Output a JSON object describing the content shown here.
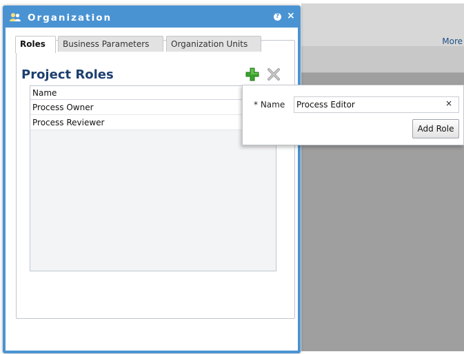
{
  "background": {
    "more_label": "More"
  },
  "dialog": {
    "title": "Organization",
    "help_glyph": "?",
    "close_glyph": "×",
    "tabs": [
      {
        "label": "Roles",
        "active": true
      },
      {
        "label": "Business Parameters",
        "active": false
      },
      {
        "label": "Organization Units",
        "active": false
      }
    ],
    "section_title": "Project Roles",
    "grid": {
      "header": "Name",
      "rows": [
        "Process Owner",
        "Process Reviewer"
      ]
    }
  },
  "popover": {
    "name_label": "* Name",
    "name_value": "Process Editor",
    "clear_glyph": "×",
    "add_button": "Add Role"
  },
  "colors": {
    "dialog_blue": "#4a93d3",
    "title_navy": "#1d3f6e",
    "add_green": "#3aa32c",
    "delete_gray": "#9a9a9a"
  },
  "icons": [
    "organization-icon",
    "help-icon",
    "close-icon",
    "add-icon",
    "delete-icon",
    "clear-icon"
  ]
}
